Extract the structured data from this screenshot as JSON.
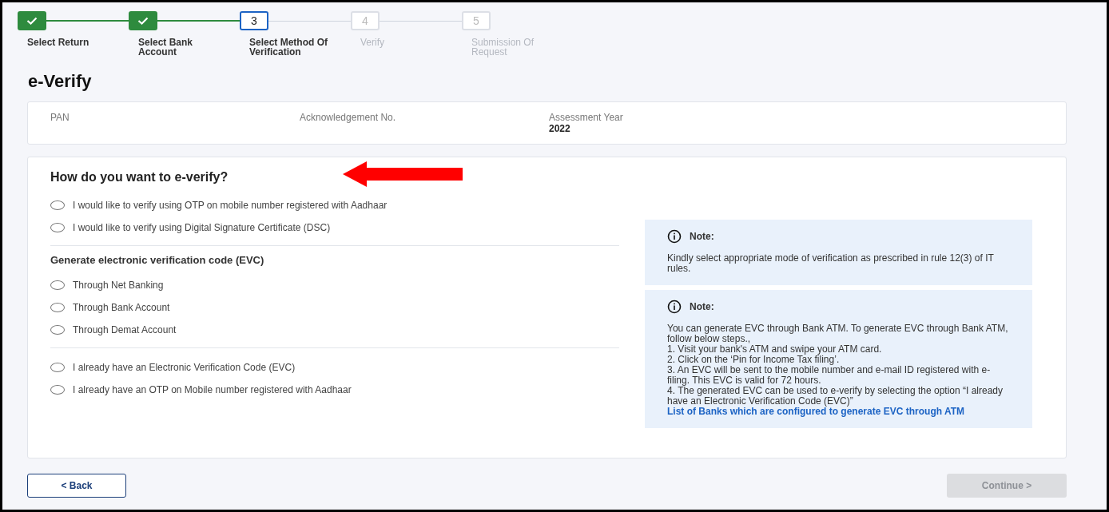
{
  "stepper": [
    {
      "label": "Select Return",
      "completed": true,
      "selected": false
    },
    {
      "label": "Select Bank Account",
      "completed": true,
      "selected": false
    },
    {
      "label": "Select Method Of Verification",
      "completed": false,
      "selected": true,
      "number": "3"
    },
    {
      "label": "Verify",
      "completed": false,
      "selected": false,
      "number": "4"
    },
    {
      "label": "Submission Of Request",
      "completed": false,
      "selected": false,
      "number": "5"
    }
  ],
  "page_title": "e-Verify",
  "summary": [
    {
      "label": "PAN"
    },
    {
      "label": "Acknowledgement No."
    },
    {
      "label": "Assessment Year",
      "value": "2022"
    }
  ],
  "question": "How do you want to e-verify?",
  "option_groups": [
    {
      "options": [
        {
          "label": "I would like to verify using OTP on mobile number registered with Aadhaar",
          "checked": false
        },
        {
          "label": "I would like to verify using Digital Signature Certificate (DSC)",
          "checked": false
        }
      ]
    },
    {
      "heading": "Generate electronic verification code (EVC)",
      "options": [
        {
          "label": "Through Net Banking",
          "checked": false
        },
        {
          "label": "Through Bank Account",
          "checked": false
        },
        {
          "label": "Through Demat Account",
          "checked": false
        }
      ]
    },
    {
      "options": [
        {
          "label": "I already have an Electronic Verification Code (EVC)",
          "checked": false
        },
        {
          "label": "I already have an OTP on Mobile number registered with Aadhaar",
          "checked": false
        }
      ]
    }
  ],
  "notes": [
    {
      "title": "Note:",
      "lines": [
        "Kindly select appropriate mode of verification as prescribed in rule 12(3) of IT rules."
      ]
    },
    {
      "title": "Note:",
      "lines": [
        "You can generate EVC through Bank ATM. To generate EVC through Bank ATM, follow below steps.,",
        "1. Visit your bank's ATM and swipe your ATM card.",
        "2. Click on the ‘Pin for Income Tax filing’.",
        "3. An EVC will be sent to the mobile number and e-mail ID registered with e-filing. This EVC is valid for 72 hours.",
        "4. The generated EVC can be used to e-verify by selecting the option “I already have an Electronic Verification Code (EVC)”"
      ],
      "link": "List of Banks which are configured to generate EVC through ATM"
    }
  ],
  "back_button": {
    "label": "< Back"
  },
  "continue_button": {
    "label": "Continue >",
    "disabled": true
  }
}
